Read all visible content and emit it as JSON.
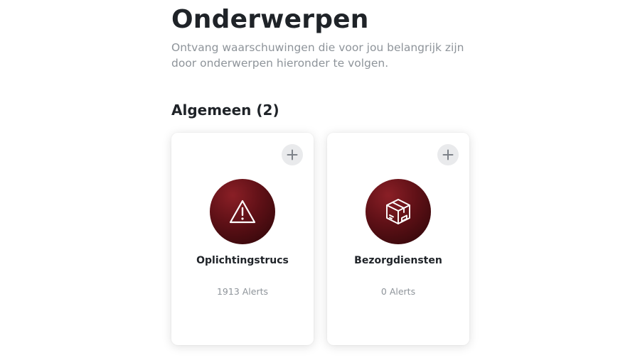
{
  "page": {
    "title": "Onderwerpen",
    "subtitle": "Ontvang waarschuwingen die voor jou belangrijk zijn door onderwerpen hieronder te volgen."
  },
  "section": {
    "title": "Algemeen (2)"
  },
  "topics": [
    {
      "name": "Oplichtingstrucs",
      "alerts": "1913 Alerts",
      "icon": "warning-triangle-icon"
    },
    {
      "name": "Bezorgdiensten",
      "alerts": "0 Alerts",
      "icon": "package-box-icon"
    }
  ],
  "colors": {
    "badge_dark": "#2a0608",
    "badge_mid": "#5e1016",
    "badge_light": "#8a1f26",
    "add_button_bg": "#e9eaec",
    "add_button_icon": "#7d8289",
    "title_text": "#1f2328",
    "muted_text": "#8e949a"
  }
}
